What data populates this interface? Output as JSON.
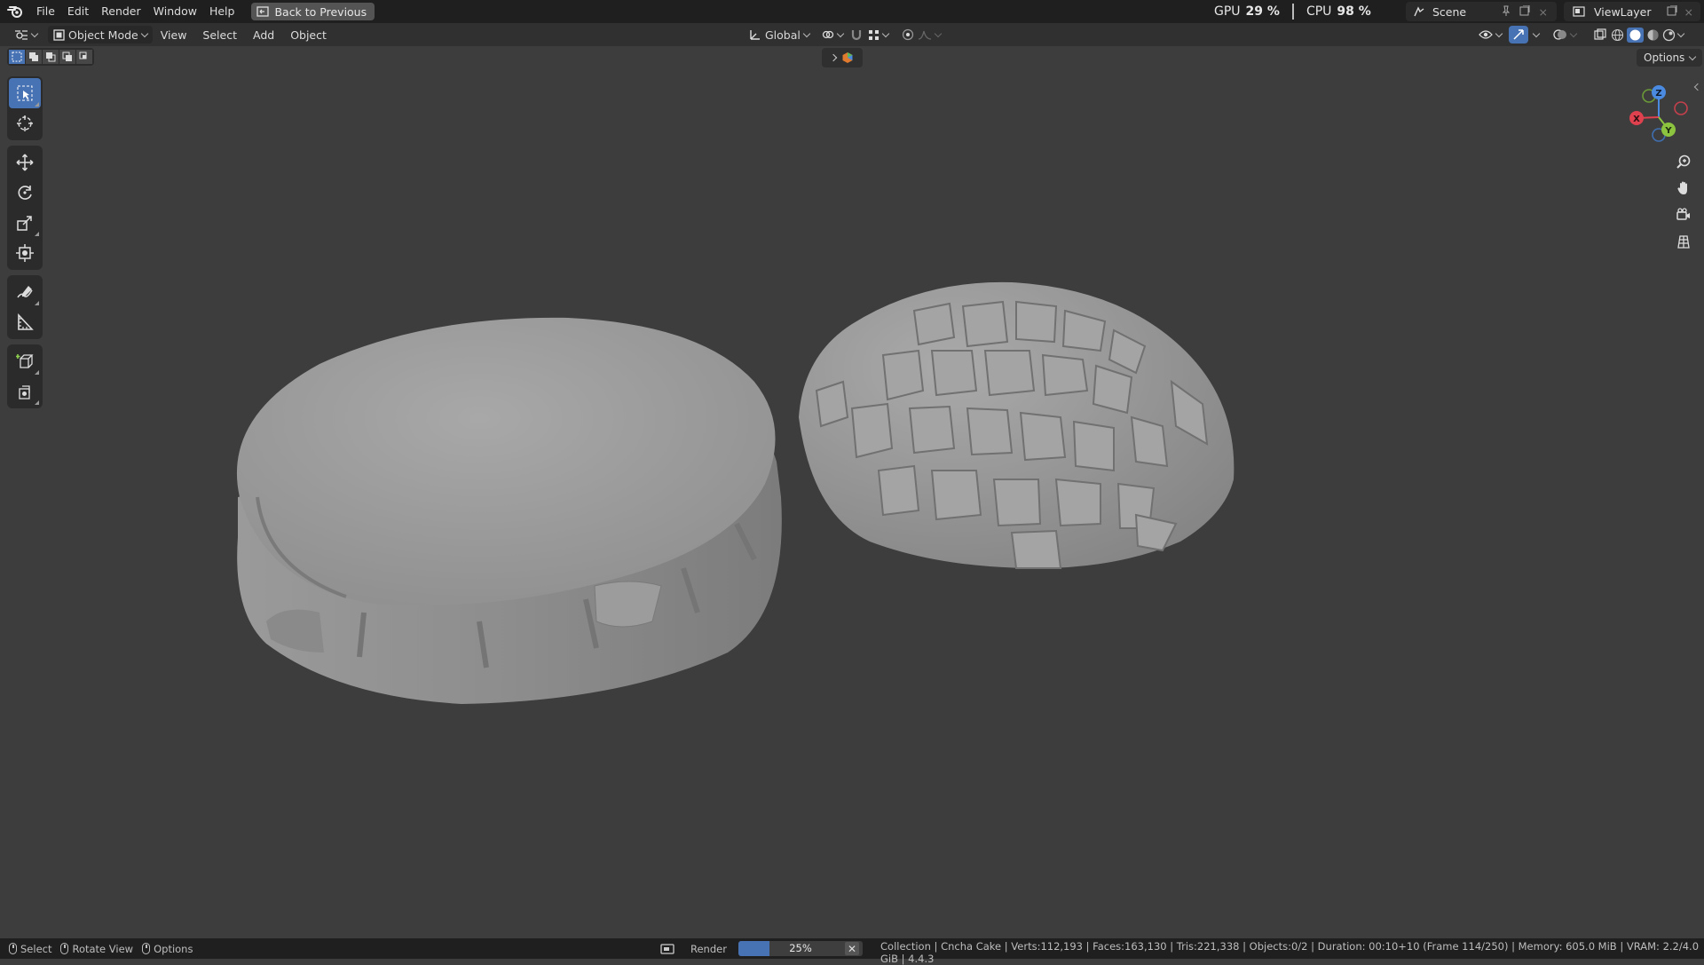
{
  "app": {
    "menu": [
      "File",
      "Edit",
      "Render",
      "Window",
      "Help"
    ],
    "back_button": "Back to Previous",
    "scene": "Scene",
    "view_layer": "ViewLayer"
  },
  "stats": {
    "gpu_label": "GPU",
    "gpu_value": "29 %",
    "cpu_label": "CPU",
    "cpu_value": "98 %"
  },
  "header": {
    "mode": "Object Mode",
    "menus": [
      "View",
      "Select",
      "Add",
      "Object"
    ],
    "transform_orientation": "Global",
    "options": "Options"
  },
  "icons": {
    "toolbar": [
      "select-box-icon",
      "cursor-icon",
      "move-icon",
      "rotate-icon",
      "scale-icon",
      "transform-icon",
      "annotate-icon",
      "measure-icon",
      "add-cube-icon",
      "add-object-icon"
    ],
    "navigation": [
      "zoom-icon",
      "pan-hand-icon",
      "camera-view-icon",
      "ortho-grid-icon"
    ]
  },
  "gizmo": {
    "x": "X",
    "y": "Y",
    "z": "Z"
  },
  "colors": {
    "accent": "#4772b3",
    "axis_x": "#e0414f",
    "axis_y": "#8cc43f",
    "axis_z": "#4a8ae0"
  },
  "statusbar": {
    "select": "Select",
    "rotate": "Rotate View",
    "options": "Options",
    "render_label": "Render",
    "progress_text": "25%",
    "progress_fraction": 0.25,
    "info": "Collection | Cncha Cake | Verts:112,193 | Faces:163,130 | Tris:221,338 | Objects:0/2 | Duration: 00:10+10 (Frame 114/250) | Memory: 605.0 MiB | VRAM: 2.2/4.0 GiB | 4.4.3"
  }
}
